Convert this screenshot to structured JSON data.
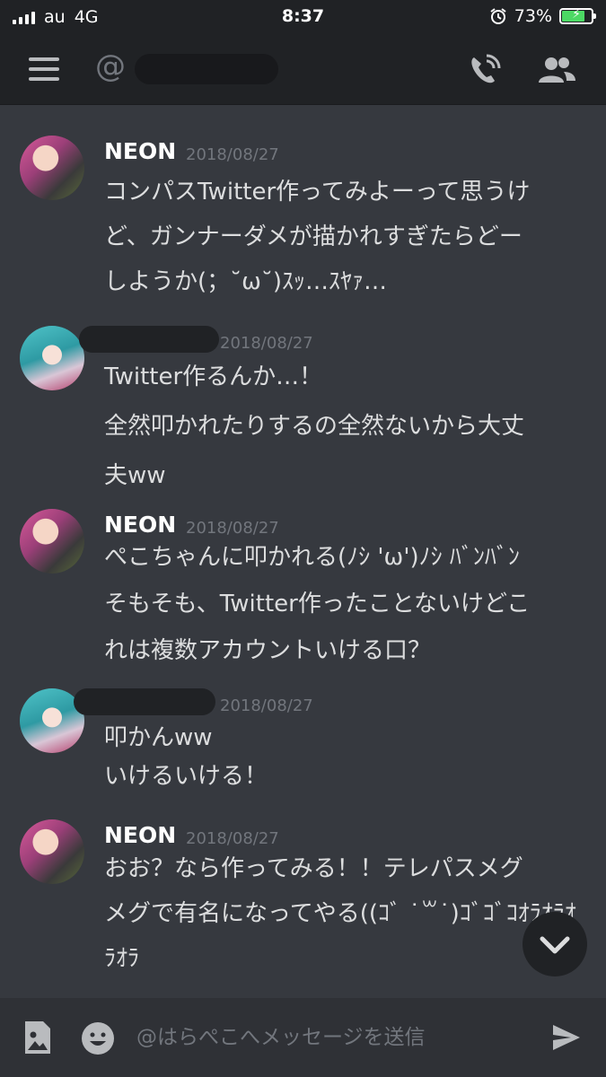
{
  "status_bar": {
    "carrier": "au",
    "network": "4G",
    "time": "8:37",
    "battery": "73%",
    "battery_level": 0.73
  },
  "header": {
    "at_symbol": "@"
  },
  "messages": [
    {
      "author": "NEON",
      "date": "2018/08/27",
      "lines": [
        "コンパスTwitter作ってみよーって思うけ",
        "ど、ガンナーダメが描かれすぎたらどー",
        "しようか(；˘ω˘)ｽｯ…ｽﾔｧ…"
      ]
    },
    {
      "author": "",
      "date": "2018/08/27",
      "lines": [
        "Twitter作るんか…！",
        "全然叩かれたりするの全然ないから大丈",
        "夫ww"
      ]
    },
    {
      "author": "NEON",
      "date": "2018/08/27",
      "lines": [
        "ぺこちゃんに叩かれる(ﾉｼ 'ω')ﾉｼ ﾊﾞﾝﾊﾞﾝ",
        "そもそも、Twitter作ったことないけどこ",
        "れは複数アカウントいける口？"
      ]
    },
    {
      "author": "",
      "date": "2018/08/27",
      "lines": [
        "叩かんww",
        "いけるいける！"
      ]
    },
    {
      "author": "NEON",
      "date": "2018/08/27",
      "lines": [
        "おお？なら作ってみる！！テレパスメグ",
        "メグで有名になってやる((ｺﾞ ˙꒳˙)ｺﾞｺﾞｺｵﾗｵﾗｵ",
        "ﾗｵﾗ"
      ]
    }
  ],
  "input": {
    "placeholder": "@はらぺこへメッセージを送信"
  },
  "colors": {
    "background": "#36393f",
    "header": "#202225",
    "input_bar": "#2f3136",
    "text": "#dcddde",
    "muted": "#72767d"
  },
  "icons": {
    "menu": "hamburger-icon",
    "call": "phone-call-icon",
    "members": "people-icon",
    "image": "image-upload-icon",
    "emoji": "emoji-icon",
    "send": "send-icon",
    "scroll": "chevron-down-icon"
  }
}
